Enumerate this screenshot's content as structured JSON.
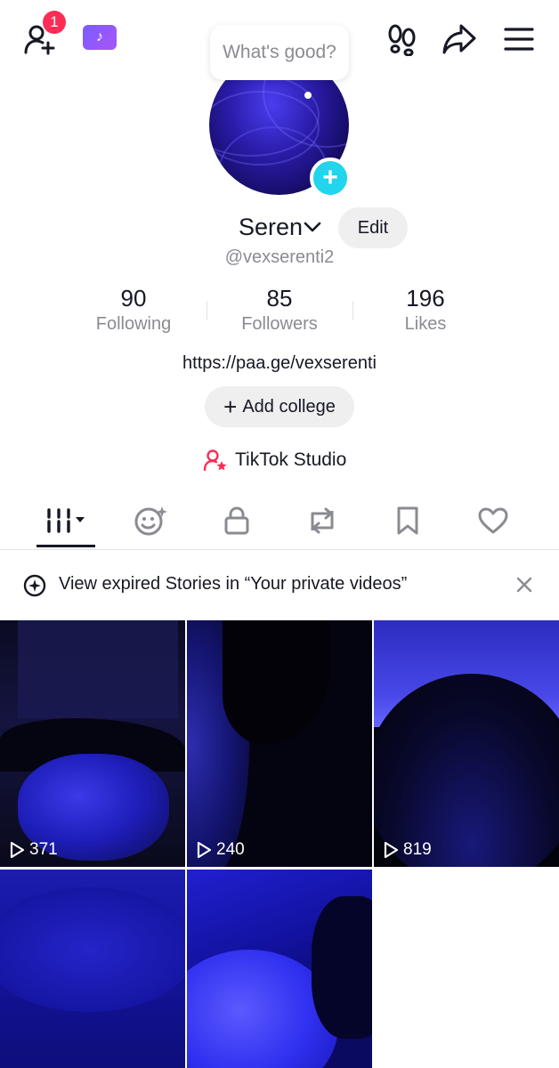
{
  "header": {
    "notification_count": "1",
    "bubble_text": "What's good?"
  },
  "profile": {
    "display_name": "Seren",
    "edit_label": "Edit",
    "handle": "@vexserenti2",
    "bio_link": "https://paa.ge/vexserenti",
    "add_college_label": "Add college",
    "studio_label": "TikTok Studio"
  },
  "stats": [
    {
      "value": "90",
      "label": "Following"
    },
    {
      "value": "85",
      "label": "Followers"
    },
    {
      "value": "196",
      "label": "Likes"
    }
  ],
  "tabs": [
    {
      "icon": "videos-grid-icon",
      "active": true
    },
    {
      "icon": "reposts-face-icon",
      "active": false
    },
    {
      "icon": "lock-icon",
      "active": false
    },
    {
      "icon": "repost-icon",
      "active": false
    },
    {
      "icon": "bookmark-icon",
      "active": false
    },
    {
      "icon": "heart-icon",
      "active": false
    }
  ],
  "notice": {
    "text": "View expired Stories in “Your private videos”"
  },
  "videos": [
    {
      "views": "371"
    },
    {
      "views": "240"
    },
    {
      "views": "819"
    },
    {
      "views": ""
    },
    {
      "views": ""
    }
  ],
  "colors": {
    "accent_red": "#fe2c55",
    "accent_cyan": "#20d5ec",
    "ticket_purple": "#8b5cf6",
    "text_primary": "#161823",
    "text_secondary": "#8a8b91"
  }
}
